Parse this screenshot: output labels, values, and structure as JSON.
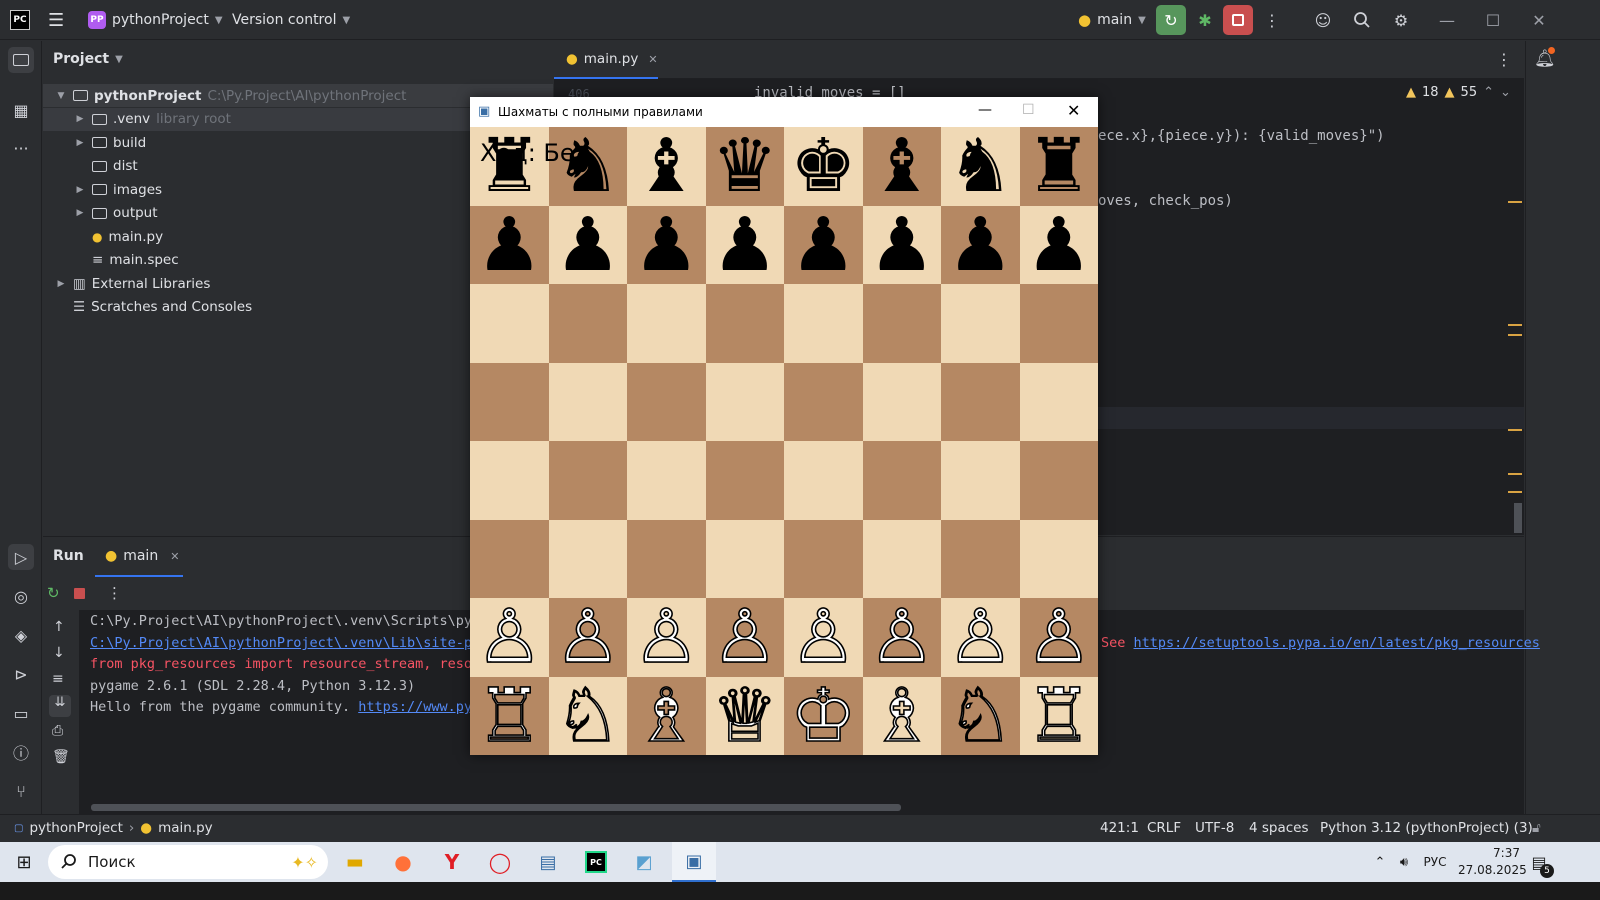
{
  "title_bar": {
    "project_badge": "PP",
    "project": "pythonProject",
    "vcs": "Version control",
    "run_config": "main"
  },
  "project_panel": {
    "title": "Project",
    "items": [
      {
        "label": "pythonProject",
        "hint": "C:\\Py.Project\\AI\\pythonProject",
        "indent": 0,
        "arrow": "down",
        "kind": "folder"
      },
      {
        "label": ".venv",
        "hint": "library root",
        "indent": 1,
        "arrow": "right",
        "kind": "folder"
      },
      {
        "label": "build",
        "hint": "",
        "indent": 1,
        "arrow": "right",
        "kind": "folder"
      },
      {
        "label": "dist",
        "hint": "",
        "indent": 1,
        "arrow": "",
        "kind": "folder"
      },
      {
        "label": "images",
        "hint": "",
        "indent": 1,
        "arrow": "right",
        "kind": "folder"
      },
      {
        "label": "output",
        "hint": "",
        "indent": 1,
        "arrow": "right",
        "kind": "folder"
      },
      {
        "label": "main.py",
        "hint": "",
        "indent": 1,
        "arrow": "",
        "kind": "python"
      },
      {
        "label": "main.spec",
        "hint": "",
        "indent": 1,
        "arrow": "",
        "kind": "text"
      },
      {
        "label": "External Libraries",
        "hint": "",
        "indent": 0,
        "arrow": "right",
        "kind": "library"
      },
      {
        "label": "Scratches and Consoles",
        "hint": "",
        "indent": 0,
        "arrow": "",
        "kind": "scratch"
      }
    ]
  },
  "editor": {
    "tab": "main.py",
    "warnings": "18",
    "weak_warnings": "55",
    "gutter_line": "406",
    "code_lines": [
      {
        "text": "invalid_moves = []",
        "prefix": ""
      },
      {
        "text": "ece.x},{piece.y}): {valid_moves}\")",
        "prefix": ""
      },
      {
        "text": "oves, check_pos)",
        "prefix": ""
      }
    ]
  },
  "run_panel": {
    "tab_run": "Run",
    "tab_main": "main",
    "lines": [
      {
        "text": "C:\\Py.Project\\AI\\pythonProject\\.venv\\Scripts\\pyth",
        "color": "#bcbec4",
        "link": ""
      },
      {
        "text": "",
        "color": "#f75464",
        "link": "C:\\Py.Project\\AI\\pythonProject\\.venv\\Lib\\site-pac"
      },
      {
        "text": "  from pkg_resources import resource_stream, reso",
        "color": "#f75464",
        "link": ""
      },
      {
        "text": "pygame 2.6.1 (SDL 2.28.4, Python 3.12.3)",
        "color": "#bcbec4",
        "link": ""
      },
      {
        "text": "Hello from the pygame community. ",
        "color": "#bcbec4",
        "link": "https://www.pyga"
      }
    ],
    "right_text": "See ",
    "right_link": "https://setuptools.pypa.io/en/latest/pkg_resources"
  },
  "statusbar": {
    "crumb_project": "pythonProject",
    "crumb_file": "main.py",
    "position": "421:1",
    "line_sep": "CRLF",
    "encoding": "UTF-8",
    "indent": "4 spaces",
    "interpreter": "Python 3.12 (pythonProject) (3)"
  },
  "taskbar": {
    "search": "Поиск",
    "lang": "РУС",
    "time": "7:37",
    "date": "27.08.2025",
    "notif": "5"
  },
  "game": {
    "title": "Шахматы с полными правилами",
    "turn_text": "Ход: Бе",
    "board": [
      [
        "♜",
        "♞",
        "♝",
        "♛",
        "♚",
        "♝",
        "♞",
        "♜"
      ],
      [
        "♟",
        "♟",
        "♟",
        "♟",
        "♟",
        "♟",
        "♟",
        "♟"
      ],
      [
        "",
        "",
        "",
        "",
        "",
        "",
        "",
        ""
      ],
      [
        "",
        "",
        "",
        "",
        "",
        "",
        "",
        ""
      ],
      [
        "",
        "",
        "",
        "",
        "",
        "",
        "",
        ""
      ],
      [
        "",
        "",
        "",
        "",
        "",
        "",
        "",
        ""
      ],
      [
        "♙",
        "♙",
        "♙",
        "♙",
        "♙",
        "♙",
        "♙",
        "♙"
      ],
      [
        "♖",
        "♘",
        "♗",
        "♕",
        "♔",
        "♗",
        "♘",
        "♖"
      ]
    ],
    "colors": {
      "light": "#f0d9b5",
      "dark": "#b58863"
    }
  }
}
